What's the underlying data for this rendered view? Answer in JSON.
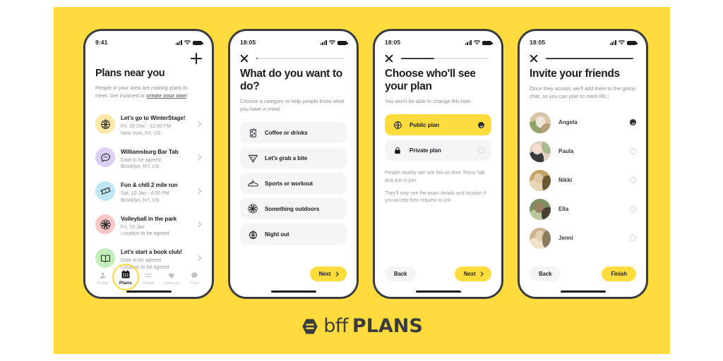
{
  "brand": {
    "logo_icon": "bumble-hexagon-icon",
    "word_light": "bff",
    "word_bold": "PLANS",
    "accent_yellow": "#ffdb3d",
    "dark": "#3b3c3e"
  },
  "screens": [
    {
      "id": "plans-near-you",
      "status": {
        "time": "9:41",
        "signal_icon": "signal-bars-icon",
        "wifi_icon": "wifi-icon",
        "battery_icon": "battery-icon"
      },
      "header_action": "add-plan-button",
      "title": "Plans near you",
      "subtitle_a": "People in your area are making plans to meet. Get involved or ",
      "subtitle_link": "create your own",
      "subtitle_b": "!",
      "plans": [
        {
          "icon": "disco-ball-icon",
          "bg": "#fce9a8",
          "title": "Let's go to WinterStage!",
          "date": "Fri, 29 Dec - 12:30 PM",
          "location": "New York, NY, US"
        },
        {
          "icon": "speech-bubble-icon",
          "bg": "#dcd0f5",
          "title": "Williamsburg Bar Tab",
          "date": "Date to be agreed",
          "location": "Brooklyn, NY, US"
        },
        {
          "icon": "ticket-icon",
          "bg": "#bfe6f5",
          "title": "Fun & chill 2 mile run",
          "date": "Sat, 10 Jan - 4:00 PM",
          "location": "Brooklyn, NY, US"
        },
        {
          "icon": "flower-icon",
          "bg": "#f8c7c6",
          "title": "Volleyball in the park",
          "date": "Fri, 15 Jan",
          "location": "Location to be agreed"
        },
        {
          "icon": "open-book-icon",
          "bg": "#c4edbc",
          "title": "Let's start a book club!",
          "date": "Date to be agreed",
          "location": "Location to be agreed"
        }
      ],
      "tabs": [
        {
          "label": "Profile",
          "icon": "person-icon",
          "active": false
        },
        {
          "label": "Plans",
          "icon": "calendar-icon",
          "active": true
        },
        {
          "label": "People",
          "icon": "people-sliders-icon",
          "active": false
        },
        {
          "label": "Liked you",
          "icon": "heart-icon",
          "active": false
        },
        {
          "label": "Chat",
          "icon": "chat-bubble-icon",
          "active": false
        }
      ]
    },
    {
      "id": "choose-category",
      "status": {
        "time": "18:05",
        "signal_icon": "signal-bars-icon",
        "wifi_icon": "wifi-icon",
        "battery_icon": "battery-icon"
      },
      "close_label": "close-icon",
      "progress_pct": 2,
      "title": "What do you want to do?",
      "subtitle": "Choose a category to help people know what you have in mind.",
      "categories": [
        {
          "label": "Coffee or drinks",
          "icon": "iced-coffee-icon"
        },
        {
          "label": "Let's grab a bite",
          "icon": "pizza-slice-icon"
        },
        {
          "label": "Sports or workout",
          "icon": "sneaker-icon"
        },
        {
          "label": "Something outdoors",
          "icon": "flower-icon"
        },
        {
          "label": "Night out",
          "icon": "disco-ball-icon"
        }
      ],
      "next_label": "Next"
    },
    {
      "id": "choose-visibility",
      "status": {
        "time": "18:05",
        "signal_icon": "signal-bars-icon",
        "wifi_icon": "wifi-icon",
        "battery_icon": "battery-icon"
      },
      "close_label": "close-icon",
      "progress_pct": 38,
      "title": "Choose who'll see your plan",
      "subtitle": "You won't be able to change this later.",
      "options": [
        {
          "label": "Public plan",
          "icon": "globe-icon",
          "selected": true
        },
        {
          "label": "Private plan",
          "icon": "lock-icon",
          "selected": false
        }
      ],
      "note_1": "People nearby can see this on their 'Plans' tab and ask to join.",
      "note_2": "They'll only see the exact details and location if you accept their request to join.",
      "back_label": "Back",
      "next_label": "Next"
    },
    {
      "id": "invite-friends",
      "status": {
        "time": "18:05",
        "signal_icon": "signal-bars-icon",
        "wifi_icon": "wifi-icon",
        "battery_icon": "battery-icon"
      },
      "close_label": "close-icon",
      "progress_pct": 100,
      "title": "Invite your friends",
      "subtitle": "Once they accept, we'll add them to the group chat, so you can plan to meet IRL!",
      "friends": [
        {
          "name": "Angela",
          "selected": true,
          "c1": "#d9c6a8",
          "c2": "#8fa36a",
          "c3": "#f0e6dc"
        },
        {
          "name": "Paula",
          "selected": false,
          "c1": "#e4cfc2",
          "c2": "#3a3a3a",
          "c3": "#a8bb8c"
        },
        {
          "name": "Nikki",
          "selected": false,
          "c1": "#c2a265",
          "c2": "#6a5a34",
          "c3": "#e8d7b4"
        },
        {
          "name": "Ella",
          "selected": false,
          "c1": "#7e8f63",
          "c2": "#4a4034",
          "c3": "#b9c79c"
        },
        {
          "name": "Jenni",
          "selected": false,
          "c1": "#cbb394",
          "c2": "#8c7a5e",
          "c3": "#efe2cd"
        }
      ],
      "back_label": "Back",
      "finish_label": "Finish"
    }
  ]
}
